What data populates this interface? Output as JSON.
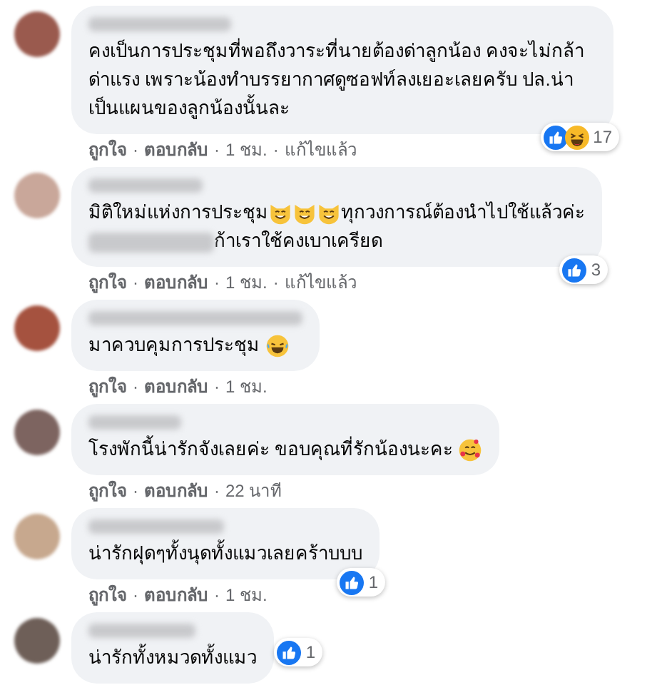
{
  "separator": "·",
  "comments": [
    {
      "body": [
        {
          "kind": "text",
          "text": "คงเป็นการประชุมที่พอถึงวาระที่นายต้องด่าลูกน้อง คงจะไม่กล้าด่าแรง เพราะน้องทำบรรยากาศดูซอฟท์ลงเยอะเลยครับ ปล.น่าเป็นแผนของลูกน้องนั้นละ"
        }
      ],
      "actions": [
        "ถูกใจ",
        "ตอบกลับ"
      ],
      "time": "1 ชม.",
      "edited": "แก้ไขแล้ว",
      "reactions": {
        "icons": [
          {
            "kind": "like"
          },
          {
            "kind": "haha"
          }
        ],
        "count": "17"
      }
    },
    {
      "body": [
        {
          "kind": "text",
          "text": "มิติใหม่แห่งการประชุม"
        },
        {
          "kind": "cat"
        },
        {
          "kind": "cat"
        },
        {
          "kind": "cat"
        },
        {
          "kind": "text",
          "text": "ทุกวงการณ์ต้องนำไปใช้แล้วค่ะ"
        },
        {
          "kind": "break"
        },
        {
          "kind": "blur"
        },
        {
          "kind": "text",
          "text": "ก้าเราใช้คงเบาเครียด"
        }
      ],
      "actions": [
        "ถูกใจ",
        "ตอบกลับ"
      ],
      "time": "1 ชม.",
      "edited": "แก้ไขแล้ว",
      "reactions": {
        "icons": [
          {
            "kind": "like"
          }
        ],
        "count": "3"
      }
    },
    {
      "body": [
        {
          "kind": "text",
          "text": "มาควบคุมการประชุม "
        },
        {
          "kind": "laugh"
        }
      ],
      "actions": [
        "ถูกใจ",
        "ตอบกลับ"
      ],
      "time": "1 ชม."
    },
    {
      "body": [
        {
          "kind": "text",
          "text": "โรงพักนี้น่ารักจังเลยค่ะ ขอบคุณที่รักน้องนะคะ "
        },
        {
          "kind": "hearts"
        }
      ],
      "actions": [
        "ถูกใจ",
        "ตอบกลับ"
      ],
      "time": "22 นาที"
    },
    {
      "body": [
        {
          "kind": "text",
          "text": "น่ารักฝุดๆทั้งนุดทั้งแมวเลยคร้าบบบ"
        }
      ],
      "actions": [
        "ถูกใจ",
        "ตอบกลับ"
      ],
      "time": "1 ชม.",
      "reactions": {
        "icons": [
          {
            "kind": "like"
          }
        ],
        "count": "1"
      }
    },
    {
      "body": [
        {
          "kind": "text",
          "text": "น่ารักทั้งหมวดทั้งแมว"
        }
      ],
      "reactions": {
        "icons": [
          {
            "kind": "like"
          }
        ],
        "count": "1"
      }
    }
  ]
}
